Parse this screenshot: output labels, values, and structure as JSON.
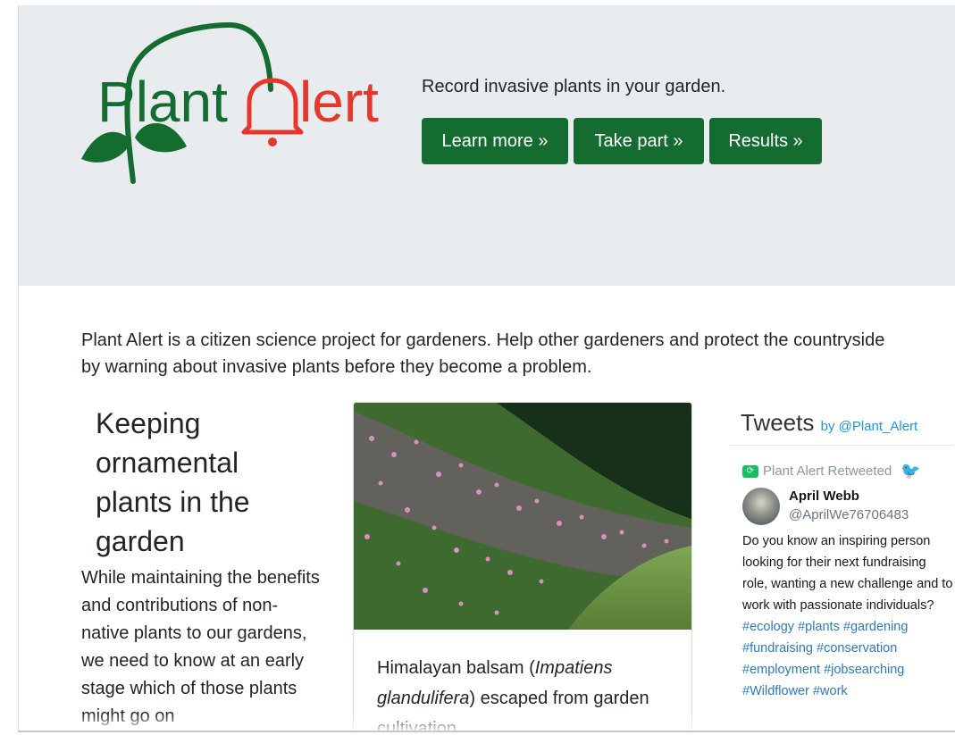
{
  "brand": {
    "logo_text_plant": "Plant",
    "logo_text_alert": "lert",
    "colors": {
      "green": "#146c31",
      "red": "#e6372d"
    }
  },
  "jumbotron": {
    "tagline": "Record invasive plants in your garden.",
    "buttons": [
      "Learn more »",
      "Take part »",
      "Results »"
    ]
  },
  "intro": "Plant Alert is a citizen science project for gardeners. Help other gardeners and protect the countryside by warning about invasive plants before they become a problem.",
  "article": {
    "title": "Keeping ornamental plants in the garden",
    "body": "While maintaining the benefits and contributions of non-native plants to our gardens, we need to know at an early stage which of those plants might go on"
  },
  "card": {
    "caption_prefix": "Himalayan balsam (",
    "caption_italic": "Impatiens glandulifera",
    "caption_suffix": ") escaped from garden cultivation."
  },
  "tweets": {
    "title": "Tweets",
    "by": "by",
    "handle": "@Plant_Alert",
    "retweeted_by": "Plant Alert Retweeted",
    "author_name": "April Webb",
    "author_handle": "@AprilWe76706483",
    "text": "Do you know an inspiring person looking for their next fundraising role, wanting a new challenge and to work with passionate individuals?",
    "hashtags": [
      "#ecology",
      "#plants",
      "#gardening",
      "#fundraising",
      "#conservation",
      "#employment",
      "#jobsearching",
      "#Wildflower",
      "#work"
    ],
    "icons": {
      "retweet": "retweet-icon",
      "bird": "twitter-bird-icon"
    }
  }
}
